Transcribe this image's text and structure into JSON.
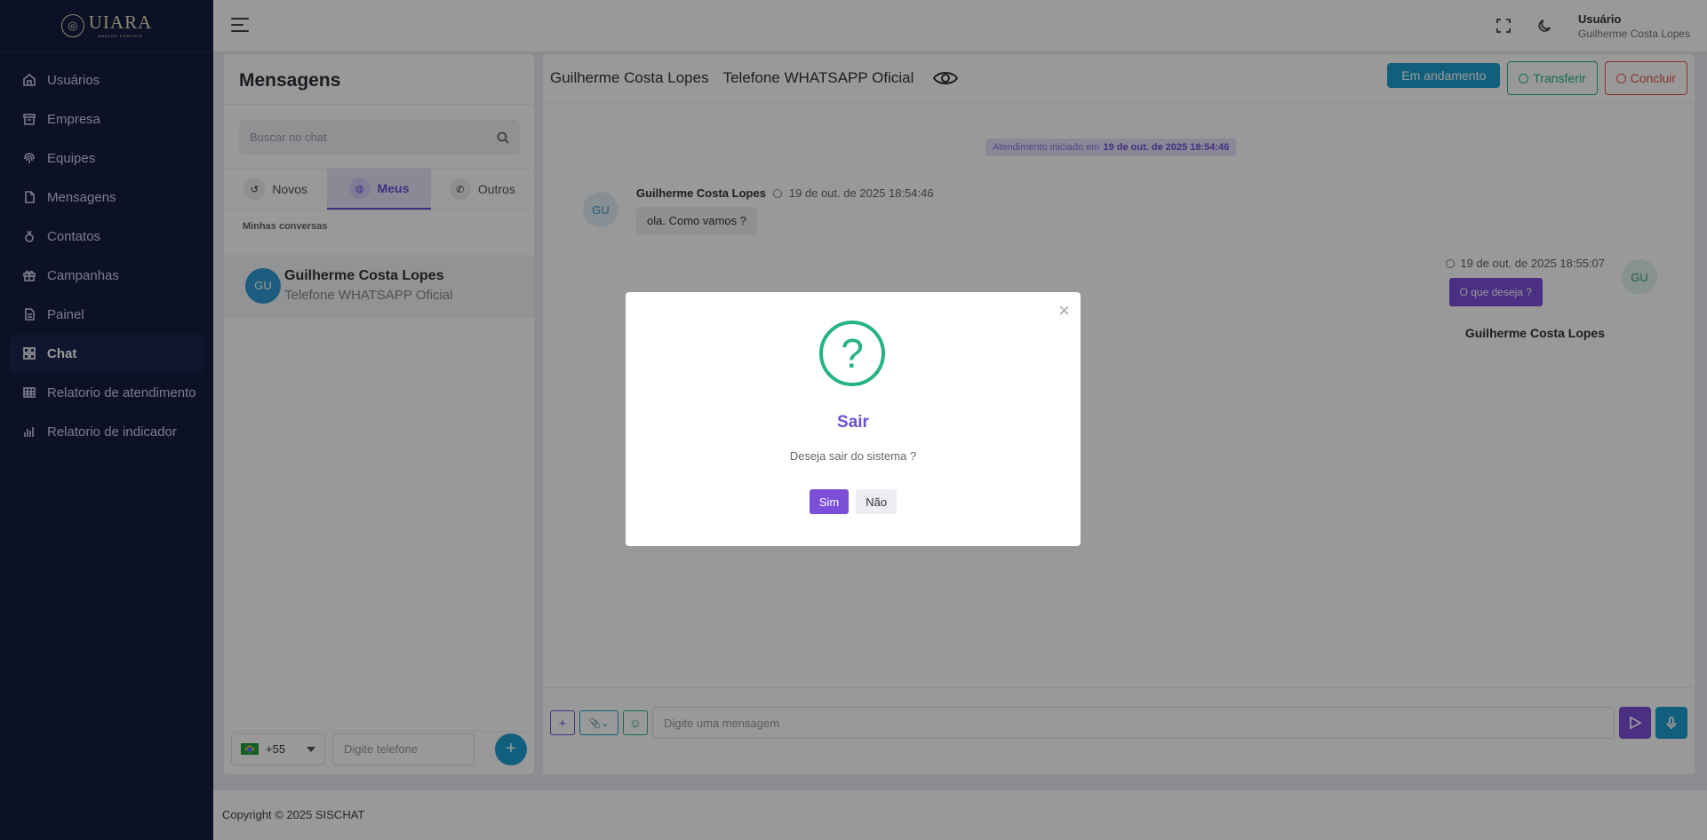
{
  "brand": {
    "name": "UIARA",
    "tagline": "AMAZON ESSENCE"
  },
  "sidebar": {
    "items": [
      {
        "label": "Usuários",
        "icon": "home-icon"
      },
      {
        "label": "Empresa",
        "icon": "archive-icon"
      },
      {
        "label": "Equipes",
        "icon": "fingerprint-icon"
      },
      {
        "label": "Mensagens",
        "icon": "file-icon"
      },
      {
        "label": "Contatos",
        "icon": "award-icon"
      },
      {
        "label": "Campanhas",
        "icon": "gift-icon"
      },
      {
        "label": "Painel",
        "icon": "document-icon"
      },
      {
        "label": "Chat",
        "icon": "grid-icon",
        "active": true
      },
      {
        "label": "Relatorio de atendimento",
        "icon": "table-icon"
      },
      {
        "label": "Relatorio de indicador",
        "icon": "bar-chart-icon"
      }
    ]
  },
  "topbar": {
    "user_title": "Usuário",
    "user_name": "Guilherme Costa Lopes"
  },
  "messages": {
    "title": "Mensagens",
    "search_placeholder": "Buscar no chat",
    "tabs": [
      {
        "label": "Novos",
        "icon": "history-icon"
      },
      {
        "label": "Meus",
        "icon": "globe-icon",
        "active": true
      },
      {
        "label": "Outros",
        "icon": "phone-icon"
      }
    ],
    "section_label": "Minhas conversas",
    "conversation": {
      "initials": "GU",
      "name": "Guilherme Costa Lopes",
      "subtitle": "Telefone WHATSAPP Oficial"
    },
    "phone": {
      "country_code": "+55",
      "placeholder": "Digite telefone",
      "add_label": "+"
    }
  },
  "chat": {
    "contact_name": "Guilherme Costa Lopes",
    "channel": "Telefone WHATSAPP Oficial",
    "btn_in_progress": "Em andamento",
    "btn_transfer": "Transferir",
    "btn_conclude": "Concluir",
    "started_prefix": "Atendimento iniciado em",
    "started_date": "19 de out. de 2025 18:54:46",
    "incoming": {
      "initials": "GU",
      "sender": "Guilherme Costa Lopes",
      "time": "19 de out. de 2025 18:54:46",
      "text": "ola. Como vamos ?"
    },
    "outgoing": {
      "initials": "GU",
      "sender": "Guilherme Costa Lopes",
      "time": "19 de out. de 2025 18:55:07",
      "text": "O que deseja ?"
    },
    "input_placeholder": "Digite uma mensagem"
  },
  "footer": {
    "text": "Copyright © 2025 SISCHAT"
  },
  "modal": {
    "title": "Sair",
    "text": "Deseja sair do sistema ?",
    "yes": "Sim",
    "no": "Não",
    "close": "×"
  },
  "colors": {
    "sidebar": "#161d3f",
    "primary": "#7c4fd9",
    "info": "#1f9fd0",
    "success": "#26b383",
    "danger": "#e55353"
  }
}
